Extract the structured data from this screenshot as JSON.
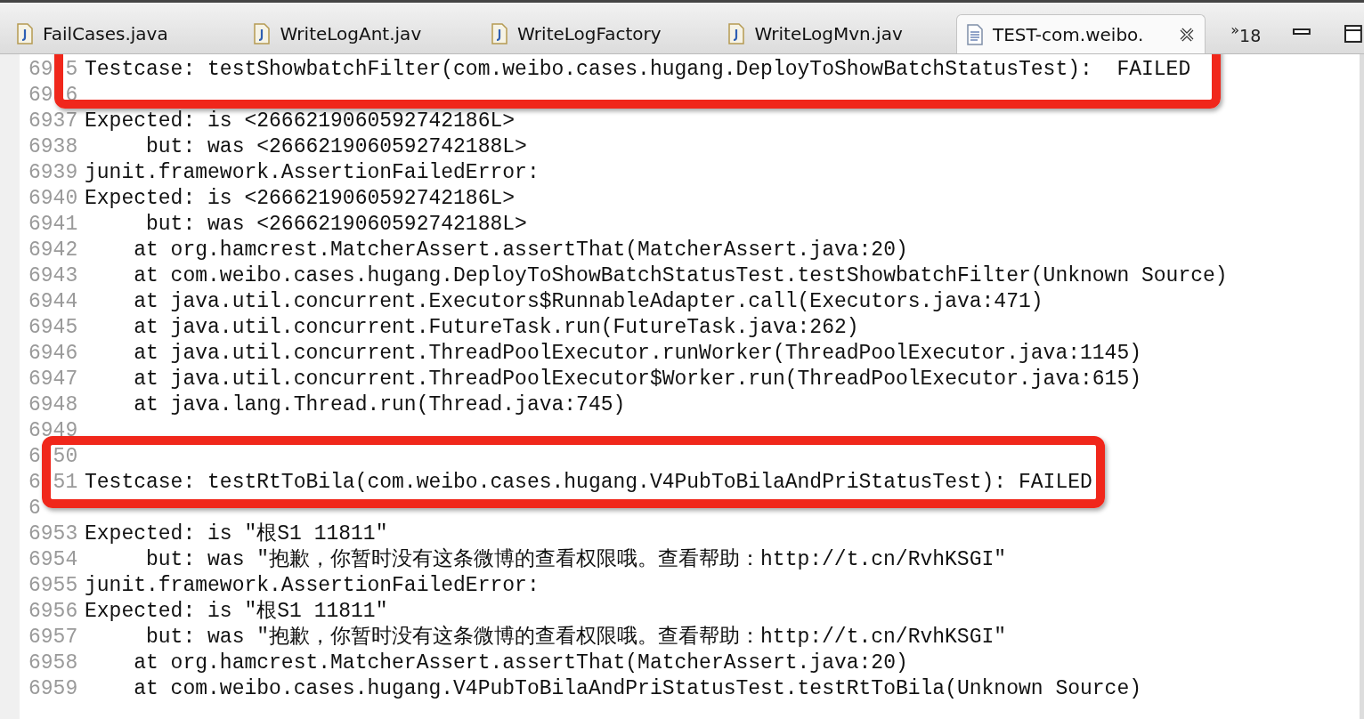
{
  "tabs": [
    {
      "label": "FailCases.java",
      "kind": "java",
      "selected": false
    },
    {
      "label": "WriteLogAnt.jav",
      "kind": "java",
      "selected": false
    },
    {
      "label": "WriteLogFactory",
      "kind": "java",
      "selected": false
    },
    {
      "label": "WriteLogMvn.jav",
      "kind": "java",
      "selected": false
    },
    {
      "label": "TEST-com.weibo.",
      "kind": "text",
      "selected": true
    }
  ],
  "overflow": {
    "marker": "»",
    "count": "18"
  },
  "lines": [
    {
      "kind": "highlight",
      "lines": [
        {
          "number": "69 5",
          "text": "Testcase: testShowbatchFilter(com.weibo.cases.hugang.DeployToShowBatchStatusTest):  FAILED"
        },
        {
          "number": "69 6"
        }
      ]
    },
    {
      "kind": "line",
      "number": "6937",
      "text": "Expected: is <2666219060592742186L>"
    },
    {
      "kind": "line",
      "number": "6938",
      "text": "     but: was <2666219060592742188L>"
    },
    {
      "kind": "line",
      "number": "6939",
      "text": "junit.framework.AssertionFailedError:"
    },
    {
      "kind": "line",
      "number": "6940",
      "text": "Expected: is <2666219060592742186L>"
    },
    {
      "kind": "line",
      "number": "6941",
      "text": "     but: was <2666219060592742188L>"
    },
    {
      "kind": "line",
      "number": "6942",
      "text": "    at org.hamcrest.MatcherAssert.assertThat(MatcherAssert.java:20)"
    },
    {
      "kind": "line",
      "number": "6943",
      "text": "    at com.weibo.cases.hugang.DeployToShowBatchStatusTest.testShowbatchFilter(Unknown Source)"
    },
    {
      "kind": "line",
      "number": "6944",
      "text": "    at java.util.concurrent.Executors$RunnableAdapter.call(Executors.java:471)"
    },
    {
      "kind": "line",
      "number": "6945",
      "text": "    at java.util.concurrent.FutureTask.run(FutureTask.java:262)"
    },
    {
      "kind": "line",
      "number": "6946",
      "text": "    at java.util.concurrent.ThreadPoolExecutor.runWorker(ThreadPoolExecutor.java:1145)"
    },
    {
      "kind": "line",
      "number": "6947",
      "text": "    at java.util.concurrent.ThreadPoolExecutor$Worker.run(ThreadPoolExecutor.java:615)"
    },
    {
      "kind": "line",
      "number": "6948",
      "text": "    at java.lang.Thread.run(Thread.java:745)"
    },
    {
      "kind": "line",
      "number": "6949"
    },
    {
      "kind": "highlight",
      "lines": [
        {
          "number": "6 50"
        },
        {
          "number": "6 51",
          "text": "Testcase: testRtToBila(com.weibo.cases.hugang.V4PubToBilaAndPriStatusTest): FAILED"
        }
      ]
    },
    {
      "kind": "line",
      "number": "6"
    },
    {
      "kind": "line",
      "number": "6953",
      "text": "Expected: is \"根S1 11811\""
    },
    {
      "kind": "line",
      "number": "6954",
      "text": "     but: was \"抱歉，你暂时没有这条微博的查看权限哦。查看帮助：http://t.cn/RvhKSGI\""
    },
    {
      "kind": "line",
      "number": "6955",
      "text": "junit.framework.AssertionFailedError:"
    },
    {
      "kind": "line",
      "number": "6956",
      "text": "Expected: is \"根S1 11811\""
    },
    {
      "kind": "line",
      "number": "6957",
      "text": "     but: was \"抱歉，你暂时没有这条微博的查看权限哦。查看帮助：http://t.cn/RvhKSGI\""
    },
    {
      "kind": "line",
      "number": "6958",
      "text": "    at org.hamcrest.MatcherAssert.assertThat(MatcherAssert.java:20)"
    },
    {
      "kind": "line",
      "number": "6959",
      "text": "    at com.weibo.cases.hugang.V4PubToBilaAndPriStatusTest.testRtToBila(Unknown Source)"
    }
  ]
}
